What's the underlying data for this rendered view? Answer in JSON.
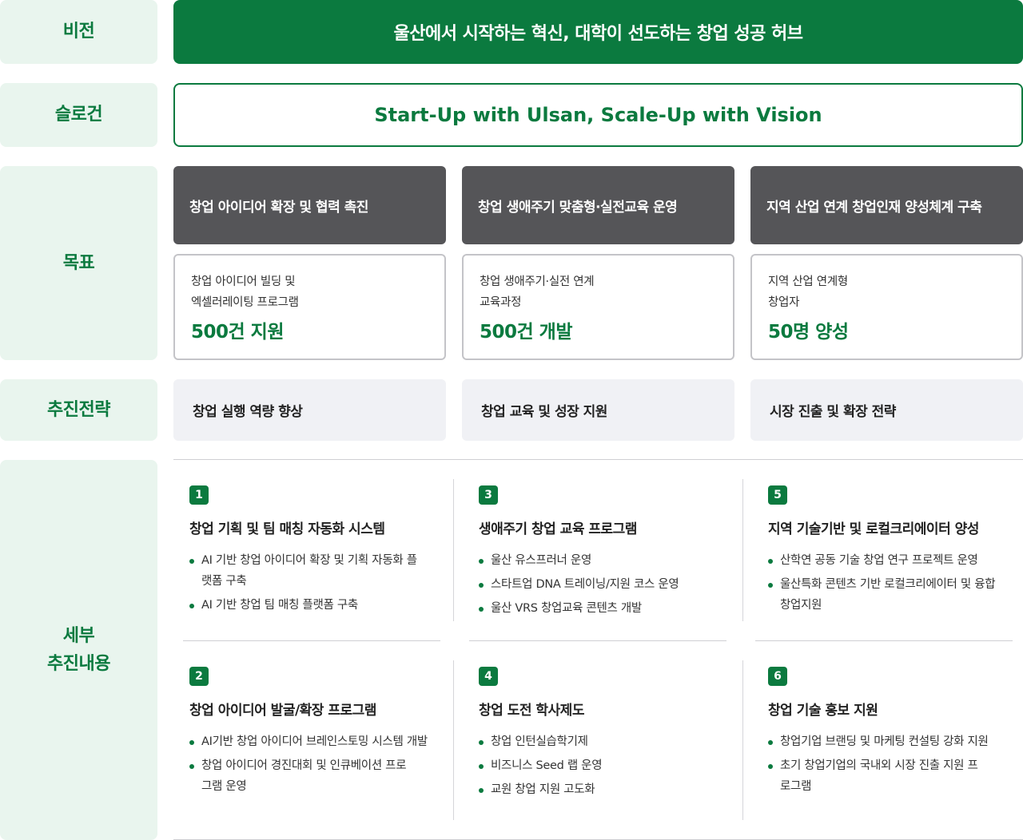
{
  "labels": {
    "vision": "비전",
    "slogan": "슬로건",
    "goal": "목표",
    "strategy": "추진전략",
    "detail_line1": "세부",
    "detail_line2": "추진내용"
  },
  "vision": "울산에서 시작하는 혁신, 대학이 선도하는 창업 성공 허브",
  "slogan": "Start-Up with Ulsan, Scale-Up with Vision",
  "goals": [
    {
      "head": "창업 아이디어 확장 및 협력 촉진",
      "desc_line1": "창업 아이디어 빌딩 및",
      "desc_line2": "엑셀러레이팅 프로그램",
      "num": "500건 지원"
    },
    {
      "head": "창업 생애주기 맞춤형·실전교육 운영",
      "desc_line1": "창업 생애주기·실전 연계",
      "desc_line2": "교육과정",
      "num": "500건 개발"
    },
    {
      "head": "지역 산업 연계 창업인재 양성체계 구축",
      "desc_line1": "지역 산업 연계형",
      "desc_line2": "창업자",
      "num": "50명 양성"
    }
  ],
  "strategies": [
    "창업 실행 역량 향상",
    "창업 교육 및 성장 지원",
    "시장 진출 및 확장 전략"
  ],
  "details": [
    {
      "num": "1",
      "title": "창업 기획 및 팀 매칭 자동화 시스템",
      "bullets": [
        "AI 기반 창업 아이디어 확장 및 기획 자동화 플랫폼 구축",
        "AI 기반 창업 팀 매칭 플랫폼 구축"
      ]
    },
    {
      "num": "3",
      "title": "생애주기 창업 교육 프로그램",
      "bullets": [
        "울산 유스프러너 운영",
        "스타트업 DNA 트레이닝/지원 코스 운영",
        "울산 VRS 창업교육 콘텐츠 개발"
      ]
    },
    {
      "num": "5",
      "title": "지역 기술기반 및 로컬크리에이터 양성",
      "bullets": [
        "산학연 공동 기술 창업 연구 프로젝트 운영",
        "울산특화 콘텐츠 기반 로컬크리에이터 및 융합 창업지원"
      ]
    },
    {
      "num": "2",
      "title": "창업 아이디어 발굴/확장 프로그램",
      "bullets": [
        "AI기반 창업 아이디어 브레인스토밍 시스템 개발",
        "창업 아이디어 경진대회 및 인큐베이션 프로그램 운영"
      ]
    },
    {
      "num": "4",
      "title": "창업 도전 학사제도",
      "bullets": [
        "창업 인턴실습학기제",
        "비즈니스 Seed 랩 운영",
        "교원 창업 지원 고도화"
      ]
    },
    {
      "num": "6",
      "title": "창업 기술 홍보 지원",
      "bullets": [
        "창업기업 브랜딩 및 마케팅 컨설팅 강화 지원",
        "초기 창업기업의 국내외 시장 진출 지원 프로그램"
      ]
    }
  ]
}
